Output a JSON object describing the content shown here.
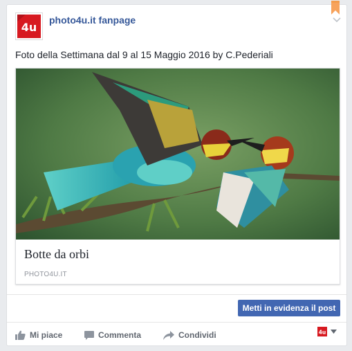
{
  "post": {
    "page_name": "photo4u.it fanpage",
    "avatar_text": "4u",
    "text": "Foto della Settimana dal 9 al 15 Maggio 2016 by C.Pederiali"
  },
  "link": {
    "title": "Botte da orbi",
    "domain": "PHOTO4U.IT"
  },
  "boost_label": "Metti in evidenza il post",
  "actions": {
    "like": "Mi piace",
    "comment": "Commenta",
    "share": "Condividi"
  },
  "colors": {
    "brand": "#d71920",
    "link": "#365899",
    "button": "#4267b2"
  }
}
